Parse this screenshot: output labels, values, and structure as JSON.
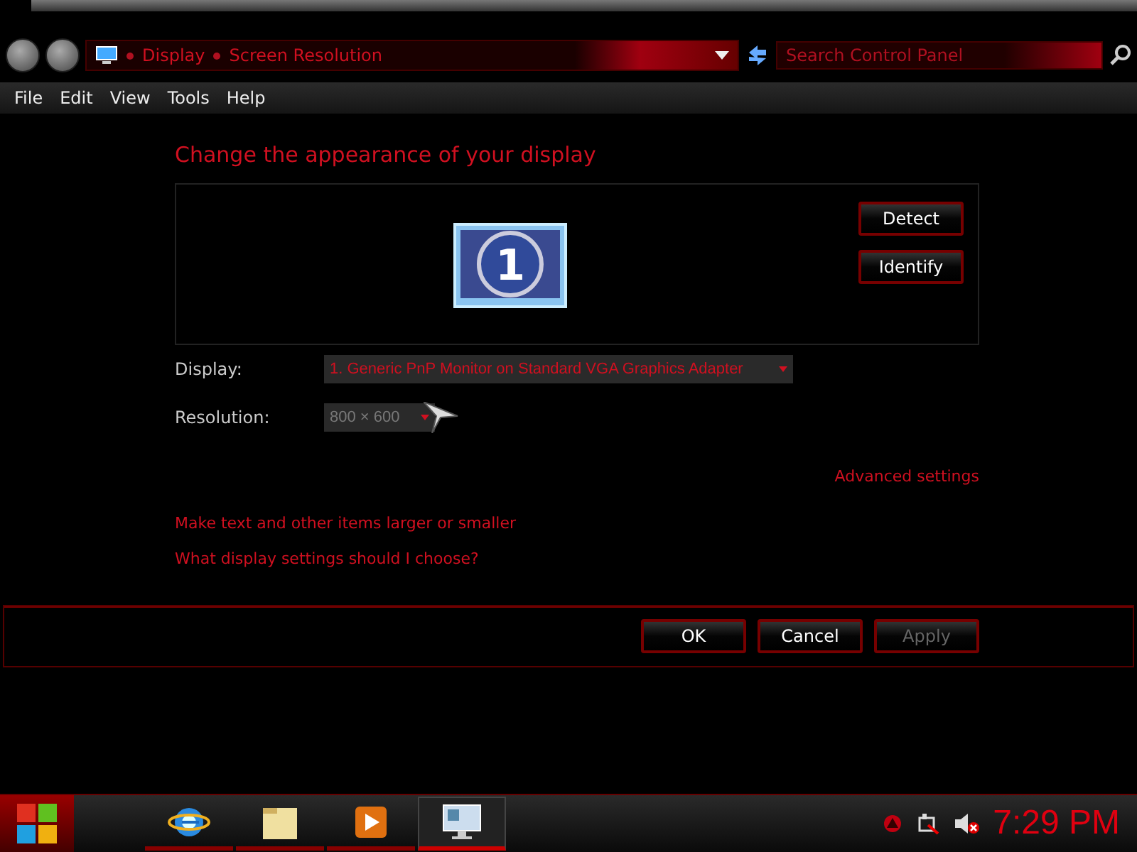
{
  "address_bar": {
    "breadcrumb": [
      "Display",
      "Screen Resolution"
    ]
  },
  "search": {
    "placeholder": "Search Control Panel"
  },
  "menu": [
    "File",
    "Edit",
    "View",
    "Tools",
    "Help"
  ],
  "heading": "Change the appearance of your display",
  "monitor": {
    "number": "1"
  },
  "monitor_buttons": [
    "Detect",
    "Identify"
  ],
  "fields": [
    {
      "label": "Display:",
      "value": "1. Generic PnP Monitor on Standard VGA Graphics Adapter",
      "kind": "wide"
    },
    {
      "label": "Resolution:",
      "value": "800 × 600",
      "kind": "narrow"
    }
  ],
  "advanced_link": "Advanced settings",
  "links": [
    "Make text and other items larger or smaller",
    "What display settings should I choose?"
  ],
  "dialog_buttons": [
    {
      "label": "OK",
      "disabled": false
    },
    {
      "label": "Cancel",
      "disabled": false
    },
    {
      "label": "Apply",
      "disabled": true
    }
  ],
  "taskbar": {
    "apps": [
      {
        "kind": "browser",
        "selected": false
      },
      {
        "kind": "folder",
        "selected": false
      },
      {
        "kind": "media",
        "selected": false
      },
      {
        "kind": "display",
        "selected": true
      }
    ],
    "clock": "7:29 PM"
  }
}
